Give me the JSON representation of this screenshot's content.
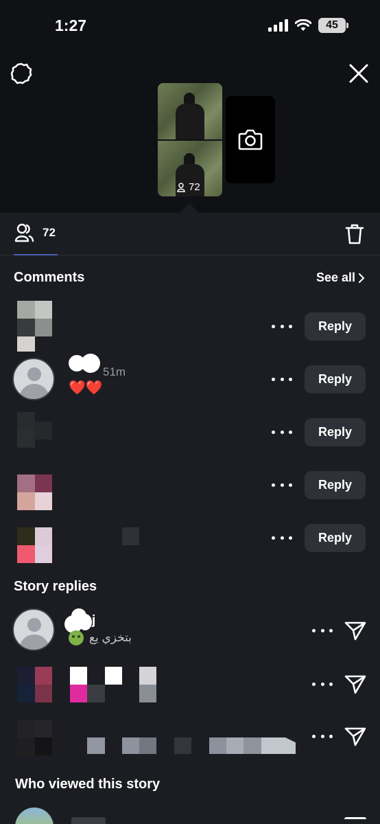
{
  "status_bar": {
    "time": "1:27",
    "battery": "45"
  },
  "story_preview": {
    "view_count": "72"
  },
  "viewers_tab": {
    "count": "72"
  },
  "comments": {
    "title": "Comments",
    "see_all": "See all",
    "rows": [
      {
        "time": "",
        "text": "",
        "reply_label": "Reply"
      },
      {
        "time": "51m",
        "text": "❤️❤️",
        "reply_label": "Reply"
      },
      {
        "time": "",
        "text": "",
        "reply_label": "Reply"
      },
      {
        "time": "",
        "text": "",
        "reply_label": "Reply"
      },
      {
        "time": "",
        "text": "",
        "reply_label": "Reply"
      }
    ]
  },
  "story_replies": {
    "title": "Story replies",
    "rows": [
      {
        "name_suffix": "j",
        "text": "بتخزي يع"
      },
      {
        "text": ""
      },
      {
        "text": ""
      }
    ]
  },
  "who_viewed": {
    "title": "Who viewed this story"
  },
  "icons": {
    "settings": "gear-icon",
    "close": "close-icon",
    "camera": "camera-icon",
    "viewers": "viewers-icon",
    "delete": "trash-icon",
    "more": "more-dots-icon",
    "send": "send-icon",
    "chevron": "chevron-right-icon"
  },
  "colors": {
    "background": "#1b1d22",
    "top_background": "#101115",
    "button": "#2e3138",
    "tab_underline": "#4a5fb0"
  }
}
